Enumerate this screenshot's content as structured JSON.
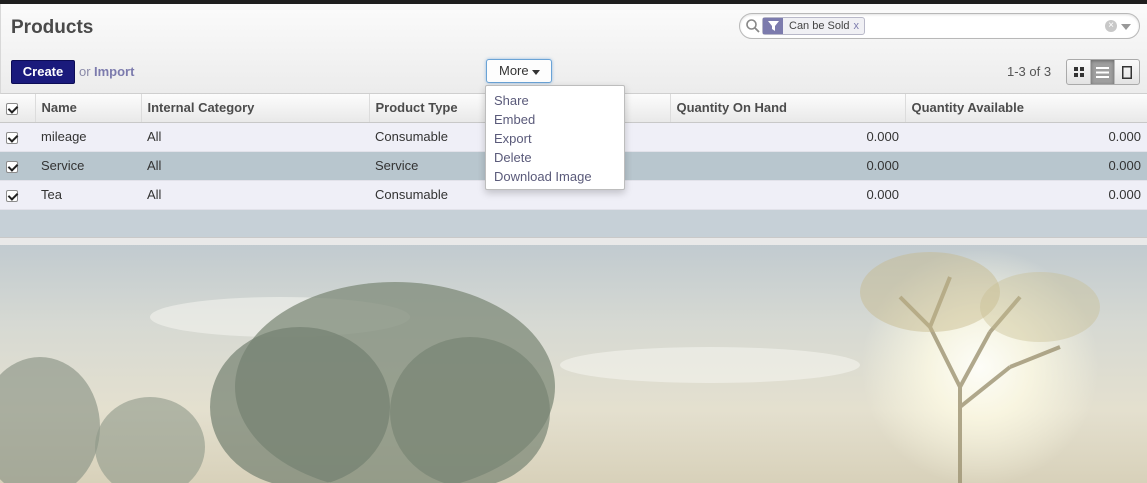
{
  "page": {
    "title": "Products"
  },
  "search": {
    "facet_label": "Can be Sold",
    "facet_remove": "x"
  },
  "toolbar": {
    "create_label": "Create",
    "or_label": "or",
    "import_label": "Import",
    "more_label": "More",
    "pager": "1-3 of 3",
    "views": [
      "kanban",
      "list",
      "form"
    ],
    "active_view": "list"
  },
  "table": {
    "columns": [
      "Name",
      "Internal Category",
      "Product Type",
      "",
      "Quantity On Hand",
      "Quantity Available"
    ],
    "rows": [
      {
        "name": "mileage",
        "category": "All",
        "type": "Consumable",
        "qty_on_hand": "0.000",
        "qty_available": "0.000"
      },
      {
        "name": "Service",
        "category": "All",
        "type": "Service",
        "qty_on_hand": "0.000",
        "qty_available": "0.000"
      },
      {
        "name": "Tea",
        "category": "All",
        "type": "Consumable",
        "qty_on_hand": "0.000",
        "qty_available": "0.000"
      }
    ]
  },
  "more_menu": {
    "items": [
      "Share",
      "Embed",
      "Export",
      "Delete",
      "Download Image"
    ]
  },
  "colors": {
    "primary": "#1a1a7c",
    "accent": "#7c7bad",
    "selected_row": "#b8c6ce",
    "row": "#efeff7"
  }
}
